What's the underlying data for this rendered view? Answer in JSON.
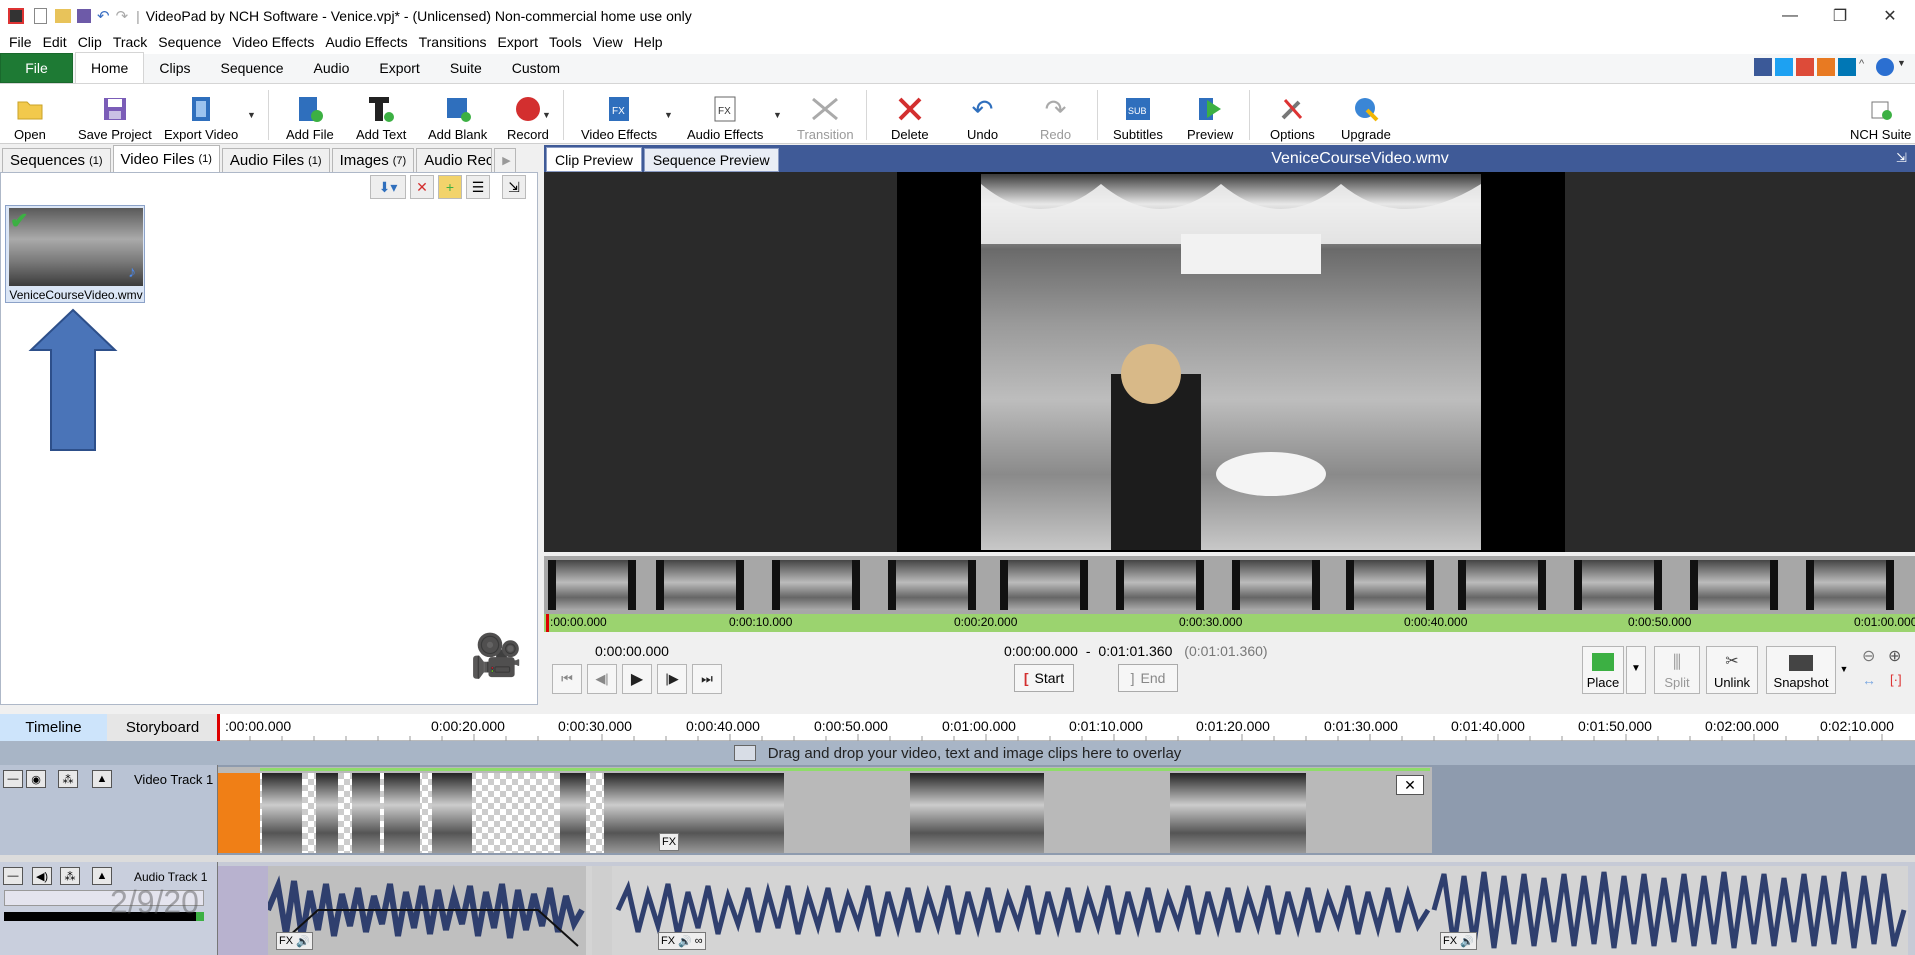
{
  "window": {
    "title": "VideoPad by NCH Software - Venice.vpj* - (Unlicensed) Non-commercial home use only",
    "minimize": "—",
    "restore": "❐",
    "close": "✕"
  },
  "menu": [
    "File",
    "Edit",
    "Clip",
    "Track",
    "Sequence",
    "Video Effects",
    "Audio Effects",
    "Transitions",
    "Export",
    "Tools",
    "View",
    "Help"
  ],
  "ribbon_tabs": [
    "File",
    "Home",
    "Clips",
    "Sequence",
    "Audio",
    "Export",
    "Suite",
    "Custom"
  ],
  "ribbon_buttons": {
    "open": "Open",
    "save_project": "Save Project",
    "export_video": "Export Video",
    "add_file": "Add File",
    "add_text": "Add Text",
    "add_blank": "Add Blank",
    "record": "Record",
    "video_effects": "Video Effects",
    "audio_effects": "Audio Effects",
    "transition": "Transition",
    "delete": "Delete",
    "undo": "Undo",
    "redo": "Redo",
    "subtitles": "Subtitles",
    "preview": "Preview",
    "options": "Options",
    "upgrade": "Upgrade",
    "nch_suite": "NCH Suite"
  },
  "bin_tabs": [
    {
      "label": "Sequences",
      "count": "(1)"
    },
    {
      "label": "Video Files",
      "count": "(1)"
    },
    {
      "label": "Audio Files",
      "count": "(1)"
    },
    {
      "label": "Images",
      "count": "(7)"
    },
    {
      "label": "Audio Rec",
      "count": ""
    }
  ],
  "media_file": "VeniceCourseVideo.wmv",
  "preview": {
    "tabs": [
      "Clip Preview",
      "Sequence Preview"
    ],
    "title": "VeniceCourseVideo.wmv",
    "ruler": [
      ":00:00.000",
      "0:00:10.000",
      "0:00:20.000",
      "0:00:30.000",
      "0:00:40.000",
      "0:00:50.000",
      "0:01:00.000"
    ],
    "current_time": "0:00:00.000",
    "range_start": "0:00:00.000",
    "range_sep": "-",
    "range_end": "0:01:01.360",
    "range_duration": "(0:01:01.360)",
    "start_label": "Start",
    "end_label": "End",
    "place": "Place",
    "split": "Split",
    "unlink": "Unlink",
    "snapshot": "Snapshot"
  },
  "timeline": {
    "tabs": [
      "Timeline",
      "Storyboard"
    ],
    "ruler": [
      ":00:00.000",
      "0:00:20.000",
      "0:00:30.000",
      "0:00:40.000",
      "0:00:50.000",
      "0:01:00.000",
      "0:01:10.000",
      "0:01:20.000",
      "0:01:30.000",
      "0:01:40.000",
      "0:01:50.000",
      "0:02:00.000",
      "0:02:10.000"
    ],
    "overlay_text": "Drag and drop your video, text and image clips here to overlay",
    "video_track": "Video Track 1",
    "audio_track": "Audio Track 1",
    "fx": "FX",
    "watermark": "2/9/20"
  },
  "colors": {
    "file_tab": "#1e7a34",
    "preview_header": "#3f5a97",
    "ruler_green": "#9bd36f",
    "arrow": "#4a74b8",
    "orange_clip": "#f07f16",
    "waveform": "#2f3f6e"
  }
}
